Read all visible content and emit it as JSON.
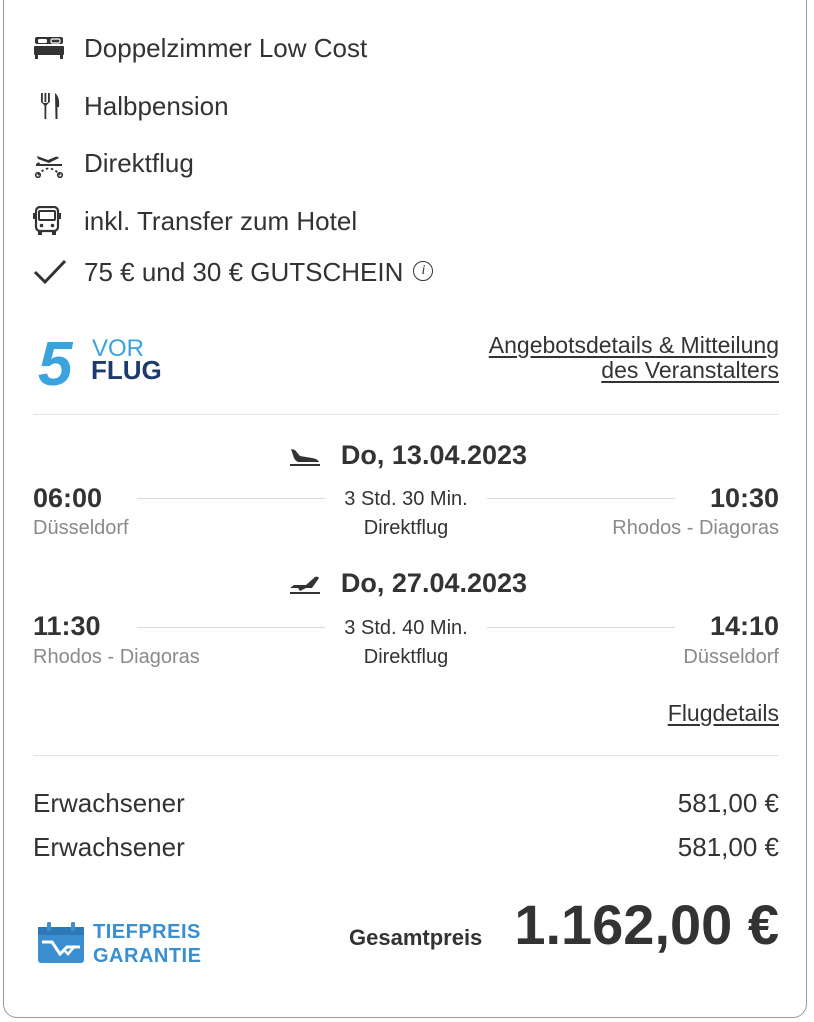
{
  "colors": {
    "text": "#333333",
    "muted": "#8a8a8a",
    "accent": "#3a8fd0",
    "logo_navy": "#1d3a6e"
  },
  "features": [
    {
      "icon": "bed-icon",
      "label": "Doppelzimmer Low Cost"
    },
    {
      "icon": "cutlery-icon",
      "label": "Halbpension"
    },
    {
      "icon": "direct-flight-icon",
      "label": "Direktflug"
    },
    {
      "icon": "bus-icon",
      "label": "inkl. Transfer zum Hotel"
    },
    {
      "icon": "checkmark-icon",
      "label": "75 € und 30 € GUTSCHEIN"
    }
  ],
  "info_icon_glyph": "i",
  "logo": {
    "number": "5",
    "top_text": "VOR",
    "bottom_text": "FLUG"
  },
  "offer_link": {
    "line1": "Angebotsdetails & Mitteilung",
    "line2": "des Veranstalters"
  },
  "outbound": {
    "icon": "plane-landing-icon",
    "date": "Do, 13.04.2023",
    "dep_time": "06:00",
    "dep_place": "Düsseldorf",
    "duration": "3 Std. 30 Min.",
    "type": "Direktflug",
    "arr_time": "10:30",
    "arr_place": "Rhodos - Diagoras"
  },
  "return": {
    "icon": "plane-takeoff-icon",
    "date": "Do, 27.04.2023",
    "dep_time": "11:30",
    "dep_place": "Rhodos - Diagoras",
    "duration": "3 Std. 40 Min.",
    "type": "Direktflug",
    "arr_time": "14:10",
    "arr_place": "Düsseldorf"
  },
  "flight_details_link": "Flugdetails",
  "prices": [
    {
      "label": "Erwachsener",
      "value": "581,00 €"
    },
    {
      "label": "Erwachsener",
      "value": "581,00 €"
    }
  ],
  "badge": {
    "line1": "TIEFPREIS",
    "line2": "GARANTIE"
  },
  "total": {
    "label": "Gesamtpreis",
    "value": "1.162,00 €"
  }
}
